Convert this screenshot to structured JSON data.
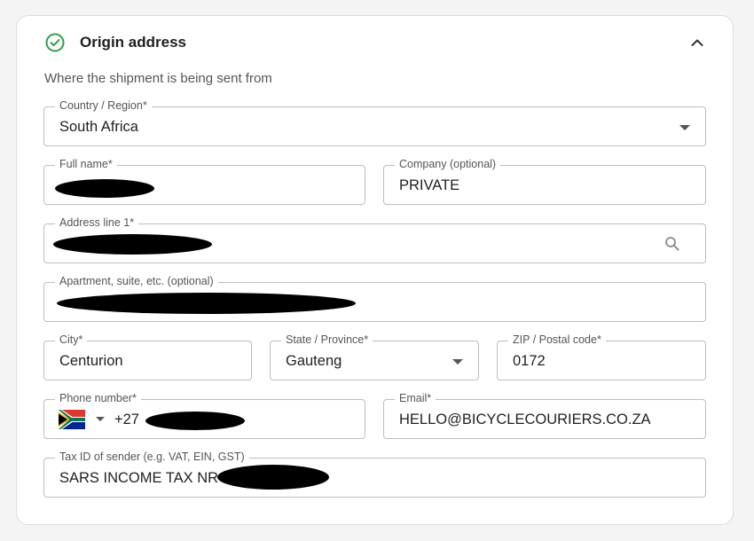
{
  "section": {
    "title": "Origin address",
    "subtitle": "Where the shipment is being sent from"
  },
  "fields": {
    "country": {
      "label": "Country / Region",
      "required_mark": "*",
      "value": "South Africa"
    },
    "full_name": {
      "label": "Full name",
      "required_mark": "*",
      "value": ""
    },
    "company": {
      "label": "Company (optional)",
      "value": "PRIVATE"
    },
    "address1": {
      "label": "Address line 1",
      "required_mark": "*",
      "value": ""
    },
    "apartment": {
      "label": "Apartment, suite, etc. (optional)",
      "value": ""
    },
    "city": {
      "label": "City",
      "required_mark": "*",
      "value": "Centurion"
    },
    "state": {
      "label": "State / Province",
      "required_mark": "*",
      "value": "Gauteng"
    },
    "zip": {
      "label": "ZIP / Postal code",
      "required_mark": "*",
      "value": "0172"
    },
    "phone": {
      "label": "Phone number",
      "required_mark": "*",
      "prefix": "+27",
      "country_flag": "south-africa-flag"
    },
    "email": {
      "label": "Email",
      "required_mark": "*",
      "value": "HELLO@BICYCLECOURIERS.CO.ZA"
    },
    "tax_id": {
      "label": "Tax ID of sender (e.g. VAT, EIN, GST)",
      "value": "SARS INCOME TAX NR"
    }
  },
  "icons": {
    "status": "check-circle-icon",
    "collapse": "chevron-up-icon",
    "search": "search-icon",
    "dropdown": "caret-down-icon"
  },
  "colors": {
    "success": "#2e9e4f",
    "border": "#bdbdbd",
    "text": "#1f1f1f",
    "label": "#555555"
  }
}
